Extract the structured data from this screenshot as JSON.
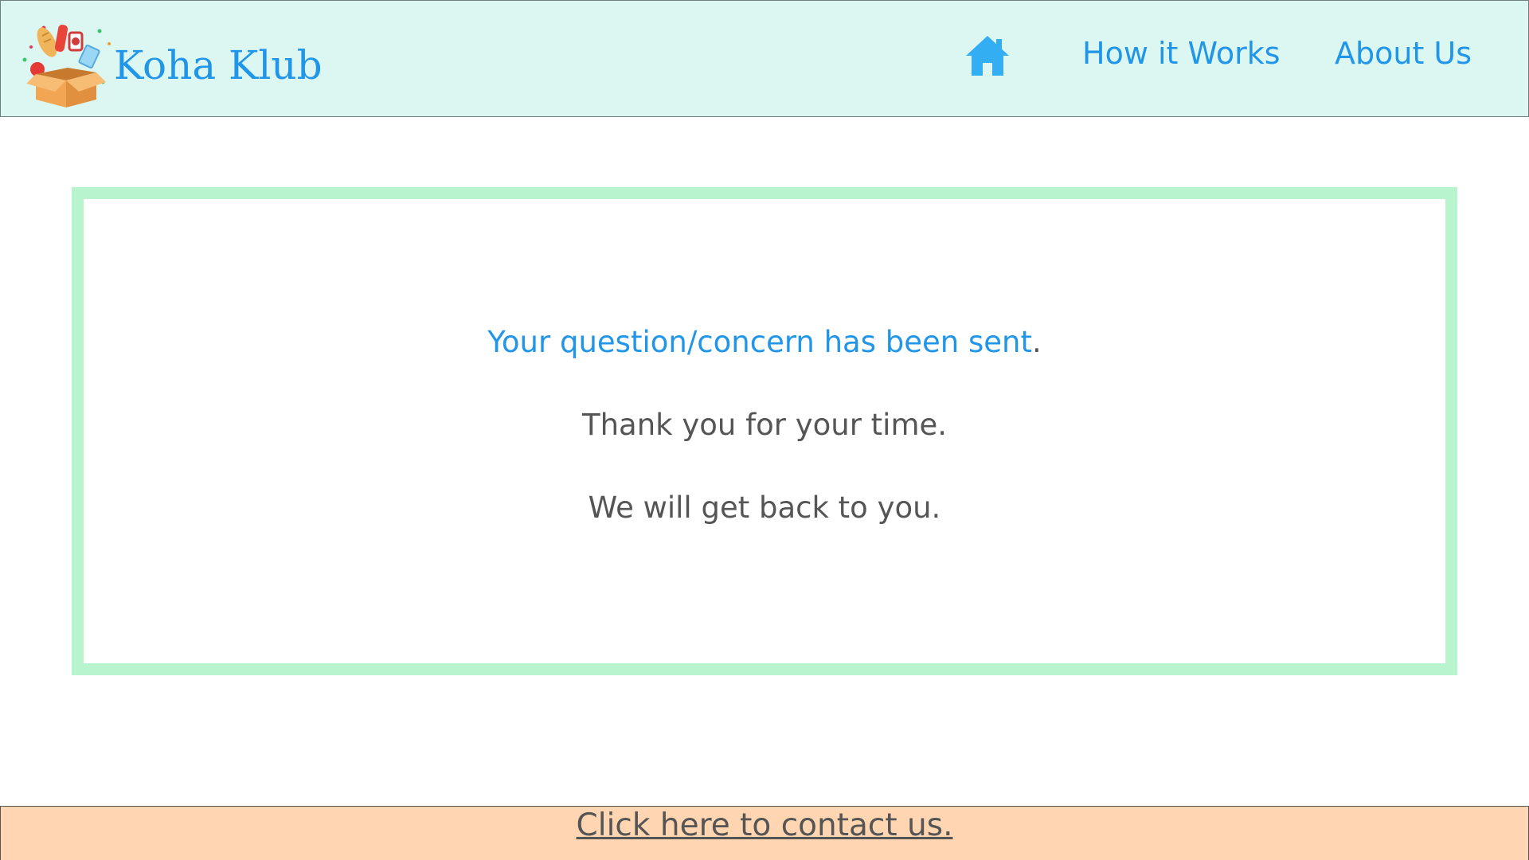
{
  "brand": {
    "name": "Koha Klub",
    "logo_icon": "grocery-box-logo-icon"
  },
  "nav": {
    "home_icon": "home-icon",
    "how_it_works": "How it Works",
    "about_us": "About Us"
  },
  "message": {
    "sent": "Your question/concern has been sent",
    "sent_period": ".",
    "thanks": "Thank you for your time.",
    "follow_up": "We will get back to you."
  },
  "footer": {
    "contact_link": "Click here to contact us."
  },
  "colors": {
    "header_bg": "#dcf7f2",
    "accent_blue": "#2196e8",
    "panel_border": "#b8f5cf",
    "footer_bg": "#ffd6b1",
    "body_text": "#555555"
  }
}
